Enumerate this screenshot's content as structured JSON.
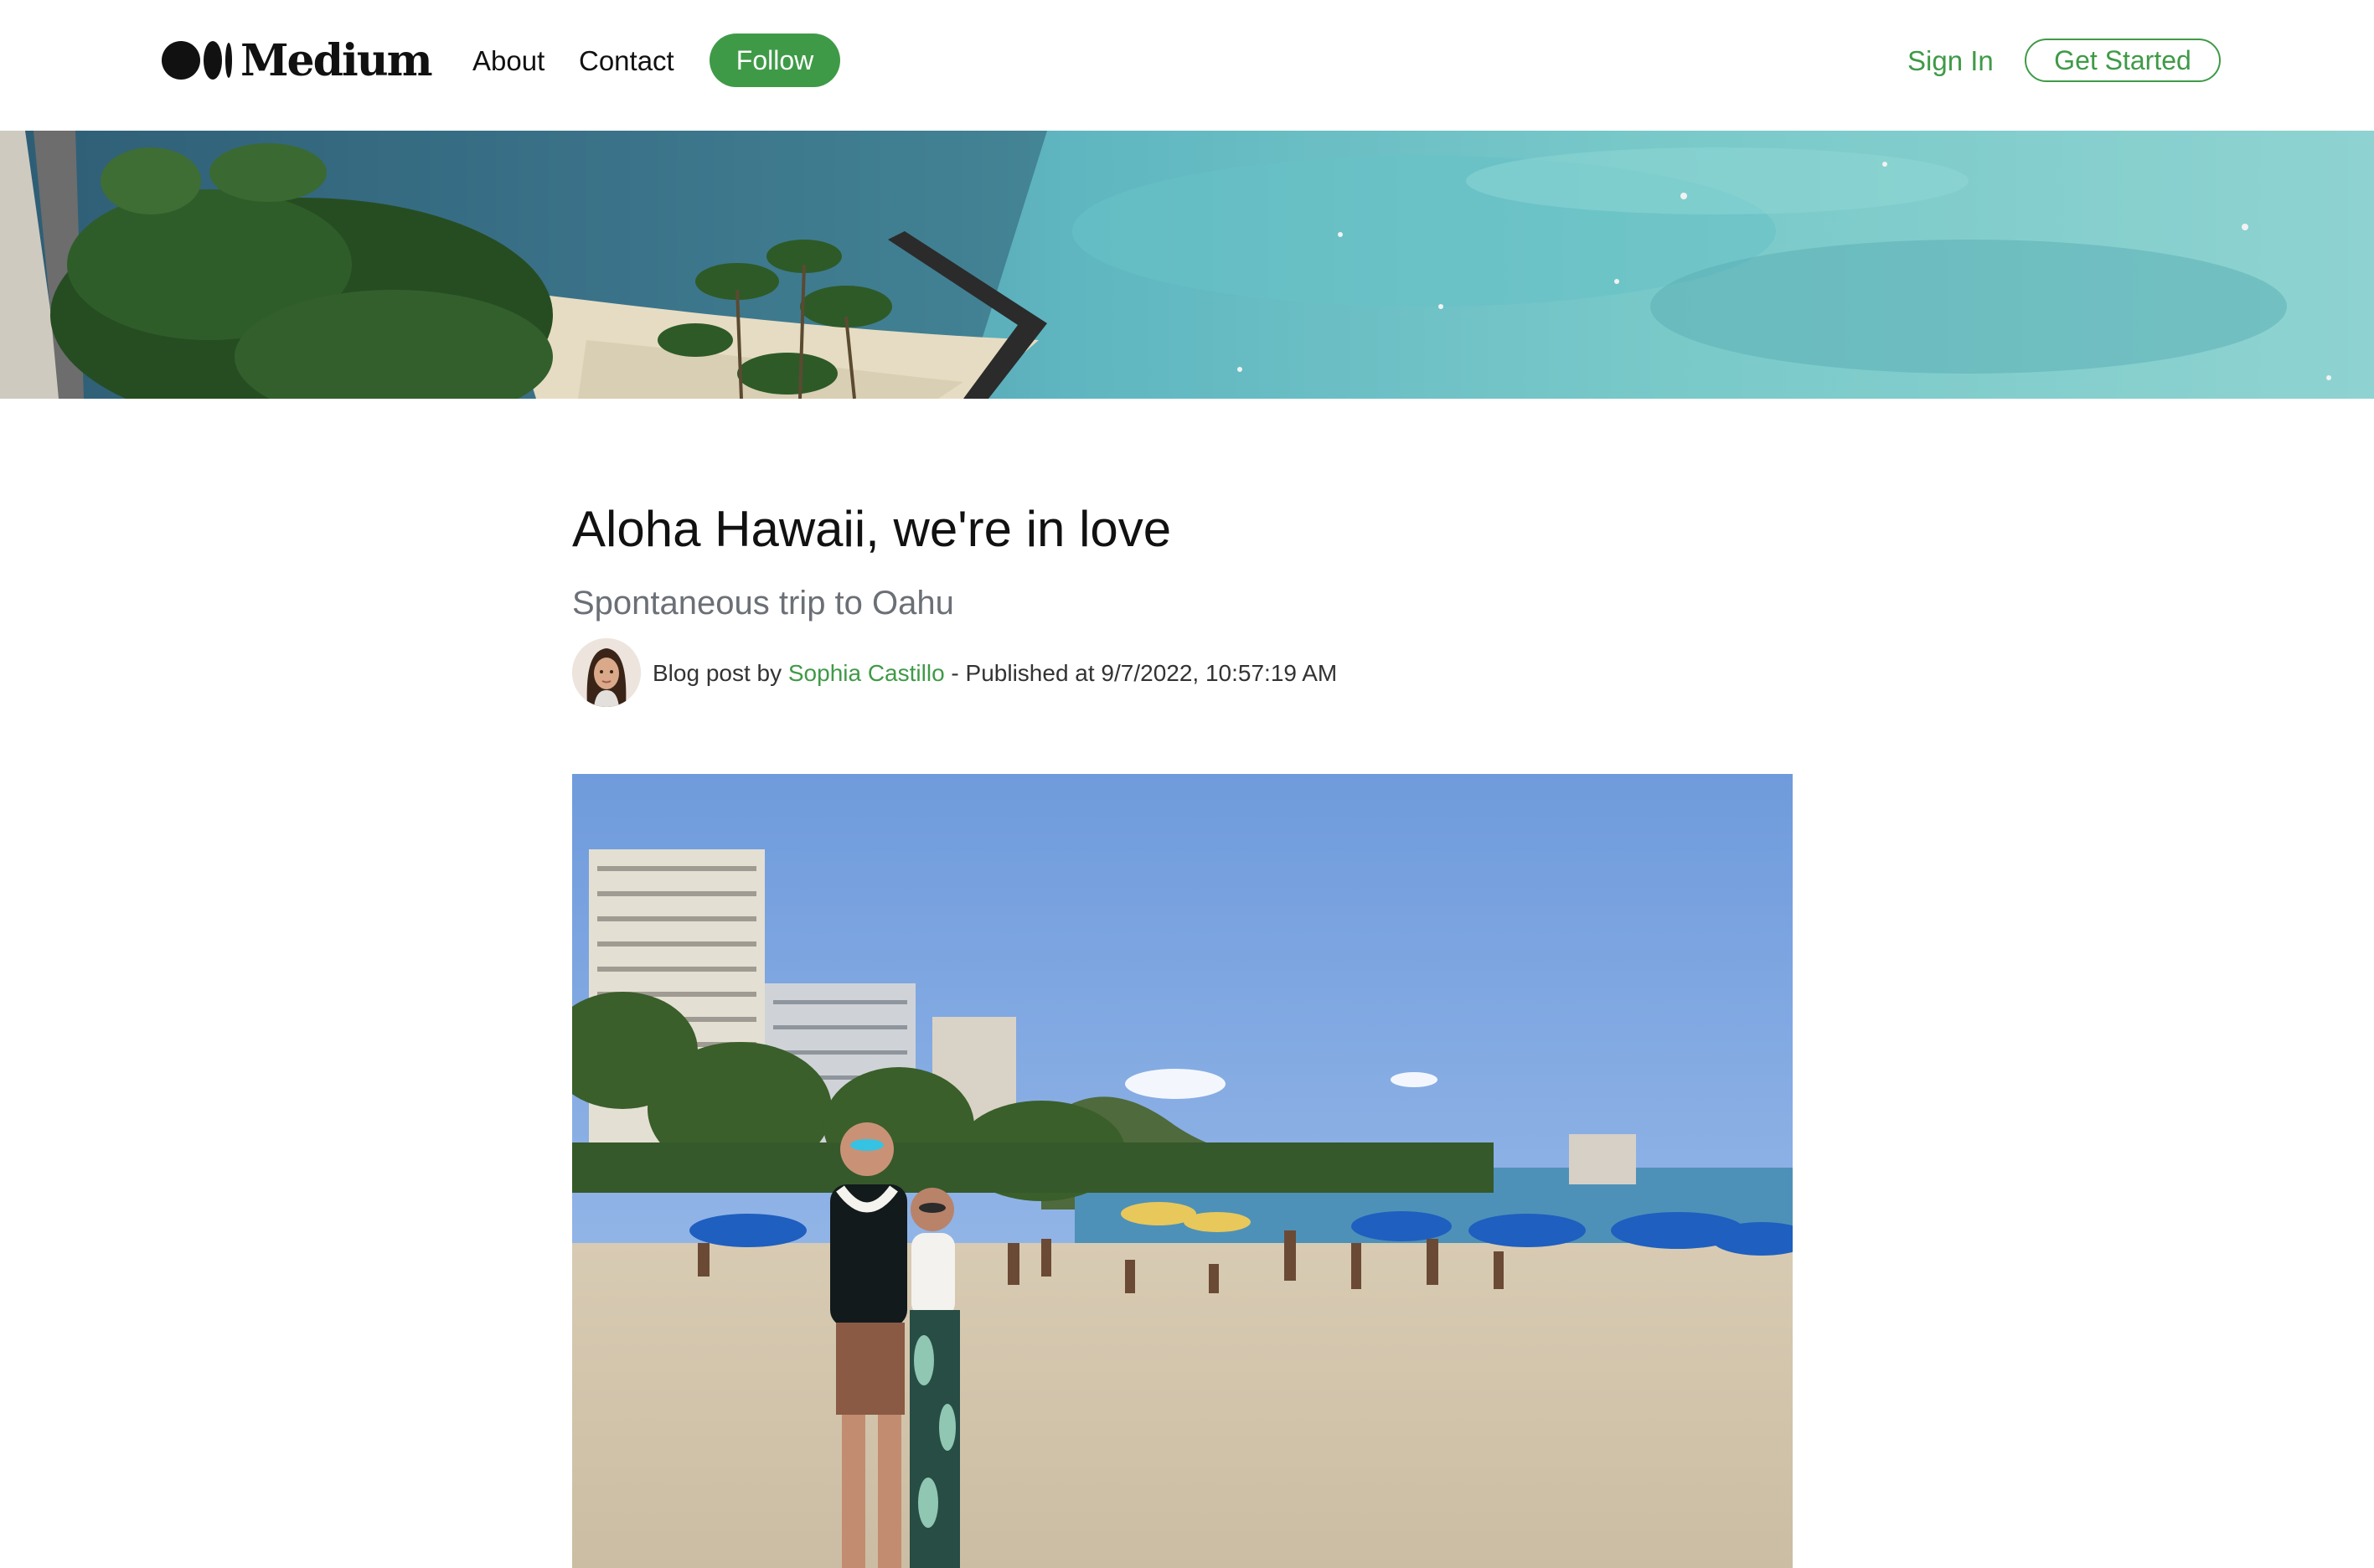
{
  "header": {
    "logo_text": "Medium",
    "nav": {
      "about": "About",
      "contact": "Contact"
    },
    "follow_label": "Follow",
    "sign_in_label": "Sign In",
    "get_started_label": "Get Started"
  },
  "article": {
    "title": "Aloha Hawaii, we're in love",
    "subtitle": "Spontaneous trip to Oahu",
    "byline_prefix": "Blog post by ",
    "author": "Sophia Castillo",
    "published_text": " - Published at 9/7/2022, 10:57:19 AM"
  },
  "colors": {
    "accent": "#3f9a47",
    "text": "#111111",
    "subtle": "#6b6f76"
  }
}
